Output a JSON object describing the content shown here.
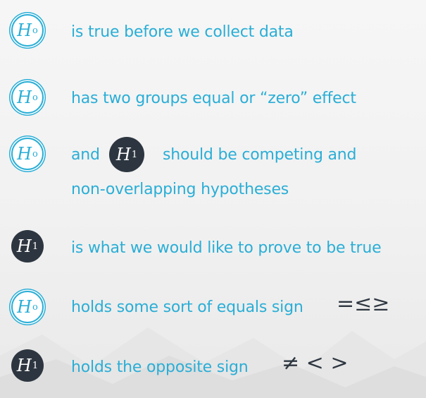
{
  "badges": {
    "h0_main": "H",
    "h0_sub": "o",
    "h1_main": "H",
    "h1_sub": "1"
  },
  "statements": [
    {
      "text": "is true before we collect data"
    },
    {
      "text": "has two groups equal or “zero” effect"
    },
    {
      "text_before": "and",
      "text_after": "should be competing and",
      "text_line2": "non-overlapping hypotheses"
    },
    {
      "text": "is what we would like to prove to be true"
    },
    {
      "text": "holds some sort of equals sign",
      "symbols": "=≤≥"
    },
    {
      "text": "holds the opposite sign",
      "symbols": "≠ < >"
    }
  ],
  "colors": {
    "accent": "#2aaed6",
    "dark": "#2d3640",
    "background": "#f3f3f3"
  }
}
